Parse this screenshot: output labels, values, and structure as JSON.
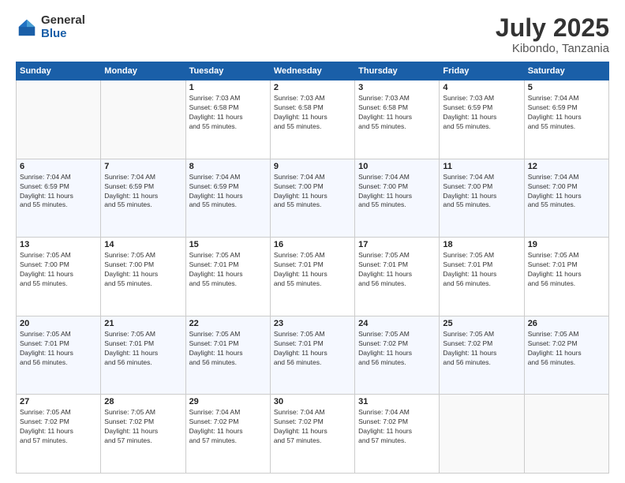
{
  "header": {
    "logo_general": "General",
    "logo_blue": "Blue",
    "title": "July 2025",
    "location": "Kibondo, Tanzania"
  },
  "days_of_week": [
    "Sunday",
    "Monday",
    "Tuesday",
    "Wednesday",
    "Thursday",
    "Friday",
    "Saturday"
  ],
  "weeks": [
    [
      {
        "day": "",
        "detail": ""
      },
      {
        "day": "",
        "detail": ""
      },
      {
        "day": "1",
        "detail": "Sunrise: 7:03 AM\nSunset: 6:58 PM\nDaylight: 11 hours\nand 55 minutes."
      },
      {
        "day": "2",
        "detail": "Sunrise: 7:03 AM\nSunset: 6:58 PM\nDaylight: 11 hours\nand 55 minutes."
      },
      {
        "day": "3",
        "detail": "Sunrise: 7:03 AM\nSunset: 6:58 PM\nDaylight: 11 hours\nand 55 minutes."
      },
      {
        "day": "4",
        "detail": "Sunrise: 7:03 AM\nSunset: 6:59 PM\nDaylight: 11 hours\nand 55 minutes."
      },
      {
        "day": "5",
        "detail": "Sunrise: 7:04 AM\nSunset: 6:59 PM\nDaylight: 11 hours\nand 55 minutes."
      }
    ],
    [
      {
        "day": "6",
        "detail": "Sunrise: 7:04 AM\nSunset: 6:59 PM\nDaylight: 11 hours\nand 55 minutes."
      },
      {
        "day": "7",
        "detail": "Sunrise: 7:04 AM\nSunset: 6:59 PM\nDaylight: 11 hours\nand 55 minutes."
      },
      {
        "day": "8",
        "detail": "Sunrise: 7:04 AM\nSunset: 6:59 PM\nDaylight: 11 hours\nand 55 minutes."
      },
      {
        "day": "9",
        "detail": "Sunrise: 7:04 AM\nSunset: 7:00 PM\nDaylight: 11 hours\nand 55 minutes."
      },
      {
        "day": "10",
        "detail": "Sunrise: 7:04 AM\nSunset: 7:00 PM\nDaylight: 11 hours\nand 55 minutes."
      },
      {
        "day": "11",
        "detail": "Sunrise: 7:04 AM\nSunset: 7:00 PM\nDaylight: 11 hours\nand 55 minutes."
      },
      {
        "day": "12",
        "detail": "Sunrise: 7:04 AM\nSunset: 7:00 PM\nDaylight: 11 hours\nand 55 minutes."
      }
    ],
    [
      {
        "day": "13",
        "detail": "Sunrise: 7:05 AM\nSunset: 7:00 PM\nDaylight: 11 hours\nand 55 minutes."
      },
      {
        "day": "14",
        "detail": "Sunrise: 7:05 AM\nSunset: 7:00 PM\nDaylight: 11 hours\nand 55 minutes."
      },
      {
        "day": "15",
        "detail": "Sunrise: 7:05 AM\nSunset: 7:01 PM\nDaylight: 11 hours\nand 55 minutes."
      },
      {
        "day": "16",
        "detail": "Sunrise: 7:05 AM\nSunset: 7:01 PM\nDaylight: 11 hours\nand 55 minutes."
      },
      {
        "day": "17",
        "detail": "Sunrise: 7:05 AM\nSunset: 7:01 PM\nDaylight: 11 hours\nand 56 minutes."
      },
      {
        "day": "18",
        "detail": "Sunrise: 7:05 AM\nSunset: 7:01 PM\nDaylight: 11 hours\nand 56 minutes."
      },
      {
        "day": "19",
        "detail": "Sunrise: 7:05 AM\nSunset: 7:01 PM\nDaylight: 11 hours\nand 56 minutes."
      }
    ],
    [
      {
        "day": "20",
        "detail": "Sunrise: 7:05 AM\nSunset: 7:01 PM\nDaylight: 11 hours\nand 56 minutes."
      },
      {
        "day": "21",
        "detail": "Sunrise: 7:05 AM\nSunset: 7:01 PM\nDaylight: 11 hours\nand 56 minutes."
      },
      {
        "day": "22",
        "detail": "Sunrise: 7:05 AM\nSunset: 7:01 PM\nDaylight: 11 hours\nand 56 minutes."
      },
      {
        "day": "23",
        "detail": "Sunrise: 7:05 AM\nSunset: 7:01 PM\nDaylight: 11 hours\nand 56 minutes."
      },
      {
        "day": "24",
        "detail": "Sunrise: 7:05 AM\nSunset: 7:02 PM\nDaylight: 11 hours\nand 56 minutes."
      },
      {
        "day": "25",
        "detail": "Sunrise: 7:05 AM\nSunset: 7:02 PM\nDaylight: 11 hours\nand 56 minutes."
      },
      {
        "day": "26",
        "detail": "Sunrise: 7:05 AM\nSunset: 7:02 PM\nDaylight: 11 hours\nand 56 minutes."
      }
    ],
    [
      {
        "day": "27",
        "detail": "Sunrise: 7:05 AM\nSunset: 7:02 PM\nDaylight: 11 hours\nand 57 minutes."
      },
      {
        "day": "28",
        "detail": "Sunrise: 7:05 AM\nSunset: 7:02 PM\nDaylight: 11 hours\nand 57 minutes."
      },
      {
        "day": "29",
        "detail": "Sunrise: 7:04 AM\nSunset: 7:02 PM\nDaylight: 11 hours\nand 57 minutes."
      },
      {
        "day": "30",
        "detail": "Sunrise: 7:04 AM\nSunset: 7:02 PM\nDaylight: 11 hours\nand 57 minutes."
      },
      {
        "day": "31",
        "detail": "Sunrise: 7:04 AM\nSunset: 7:02 PM\nDaylight: 11 hours\nand 57 minutes."
      },
      {
        "day": "",
        "detail": ""
      },
      {
        "day": "",
        "detail": ""
      }
    ]
  ]
}
